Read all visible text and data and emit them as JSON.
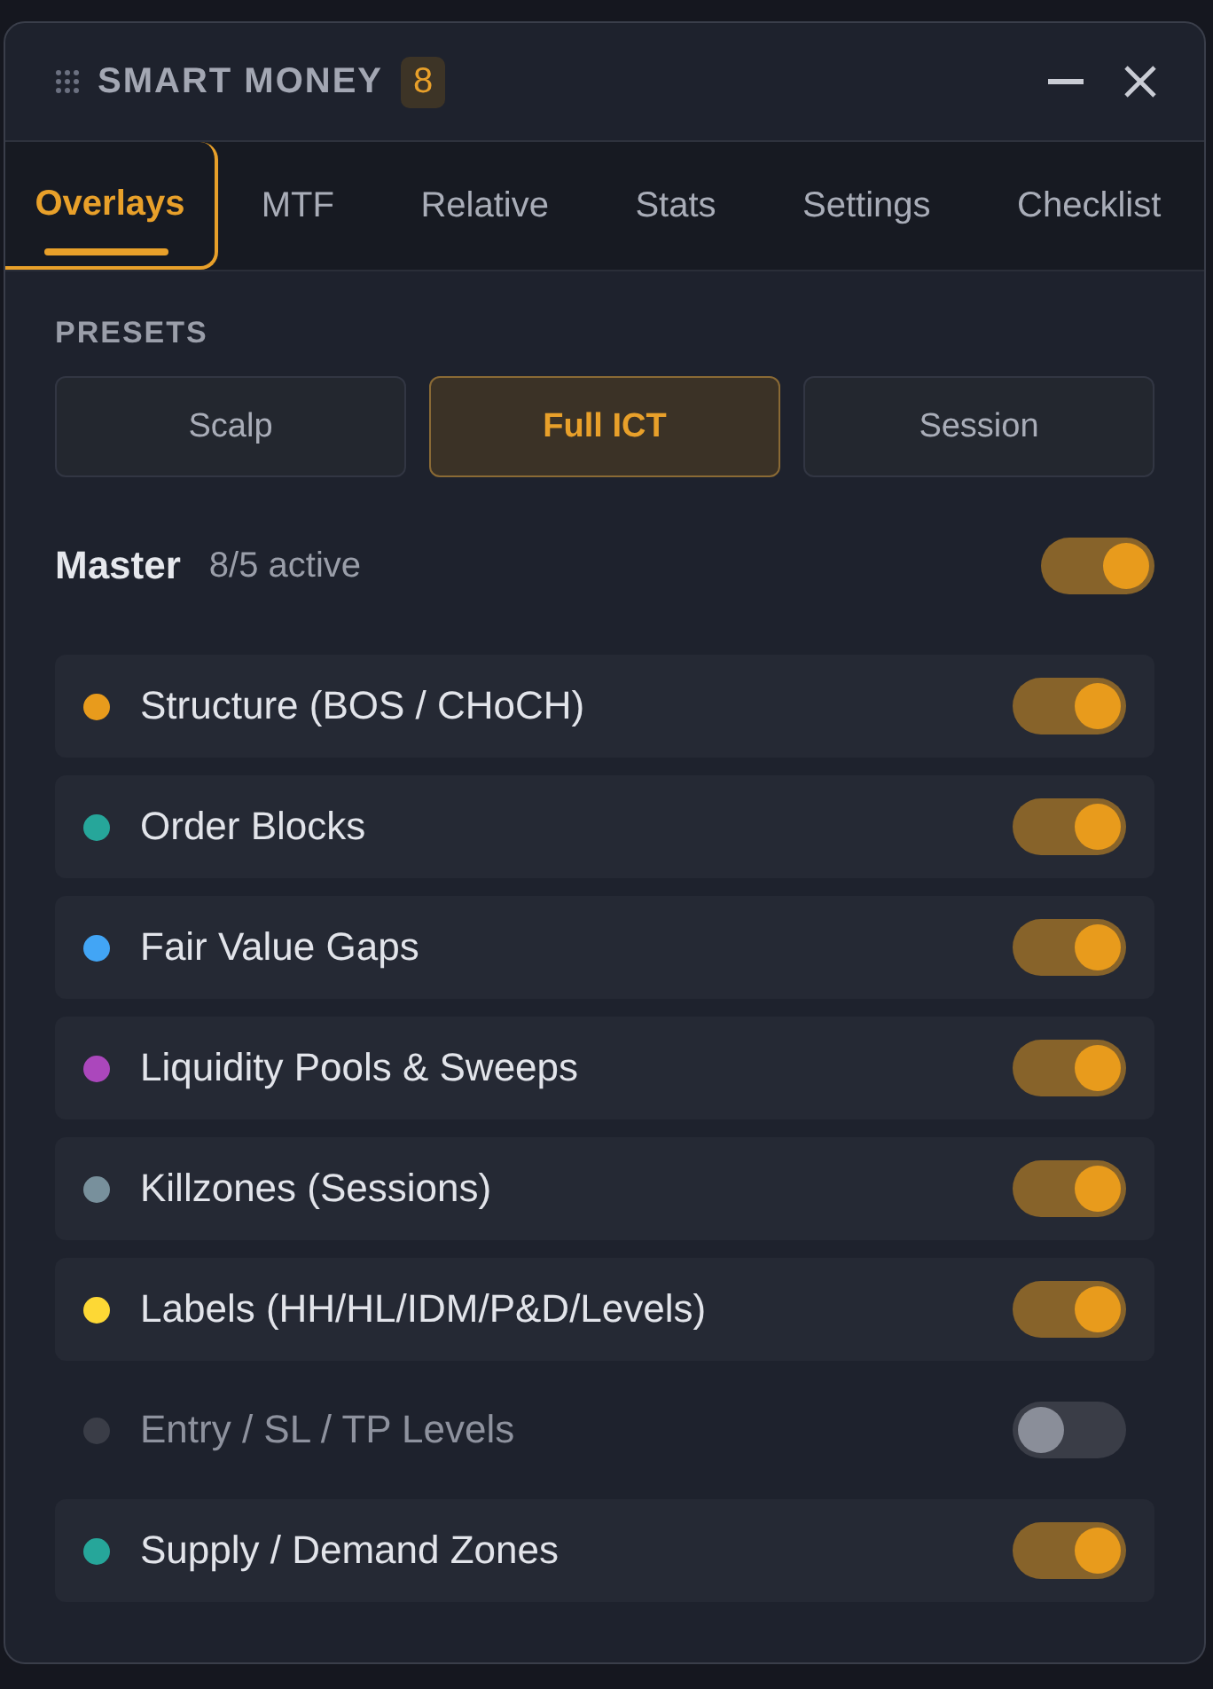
{
  "window": {
    "title": "SMART MONEY",
    "badge": "8"
  },
  "tabs": [
    {
      "label": "Overlays",
      "selected": true
    },
    {
      "label": "MTF",
      "selected": false
    },
    {
      "label": "Relative",
      "selected": false
    },
    {
      "label": "Stats",
      "selected": false
    },
    {
      "label": "Settings",
      "selected": false
    },
    {
      "label": "Checklist",
      "selected": false
    }
  ],
  "presets": {
    "heading": "PRESETS",
    "items": [
      {
        "label": "Scalp",
        "selected": false
      },
      {
        "label": "Full ICT",
        "selected": true
      },
      {
        "label": "Session",
        "selected": false
      }
    ]
  },
  "master": {
    "label": "Master",
    "count": "8/5 active",
    "on": true
  },
  "overlays": [
    {
      "name": "Structure (BOS / CHoCH)",
      "color": "#e89b1c",
      "on": true
    },
    {
      "name": "Order Blocks",
      "color": "#26a69a",
      "on": true
    },
    {
      "name": "Fair Value Gaps",
      "color": "#42a5f5",
      "on": true
    },
    {
      "name": "Liquidity Pools & Sweeps",
      "color": "#ab47bc",
      "on": true
    },
    {
      "name": "Killzones (Sessions)",
      "color": "#78909c",
      "on": true
    },
    {
      "name": "Labels (HH/HL/IDM/P&D/Levels)",
      "color": "#fdd835",
      "on": true
    },
    {
      "name": "Entry / SL / TP Levels",
      "color": "#3a3d47",
      "on": false
    },
    {
      "name": "Supply / Demand Zones",
      "color": "#26a69a",
      "on": true
    }
  ]
}
